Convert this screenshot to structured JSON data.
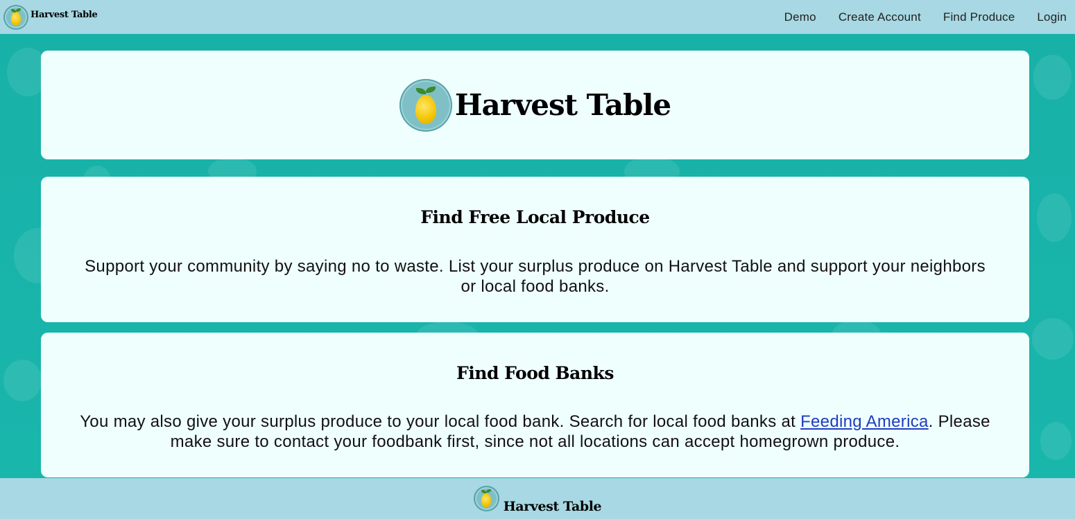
{
  "nav": {
    "brand": "Harvest Table",
    "links": [
      "Demo",
      "Create Account",
      "Find Produce",
      "Login"
    ]
  },
  "hero": {
    "title": "Harvest Table"
  },
  "produce_card": {
    "heading": "Find Free Local Produce",
    "body": "Support your community by saying no to waste. List your surplus produce on Harvest Table and support your neighbors or local food banks."
  },
  "foodbanks_card": {
    "heading": "Find Food Banks",
    "body_before_link": "You may also give your surplus produce to your local food bank. Search for local food banks at ",
    "link_text": "Feeding America",
    "body_after_link": ". Please make sure to contact your foodbank first, since not all locations can accept homegrown produce."
  },
  "footer": {
    "brand": "Harvest Table"
  },
  "colors": {
    "nav_bg": "#a7d8e3",
    "page_bg": "#1ab3aa",
    "card_bg": "#effffe",
    "link": "#1f3bbf"
  },
  "icons": {
    "logo": "lemon-logo-icon"
  }
}
